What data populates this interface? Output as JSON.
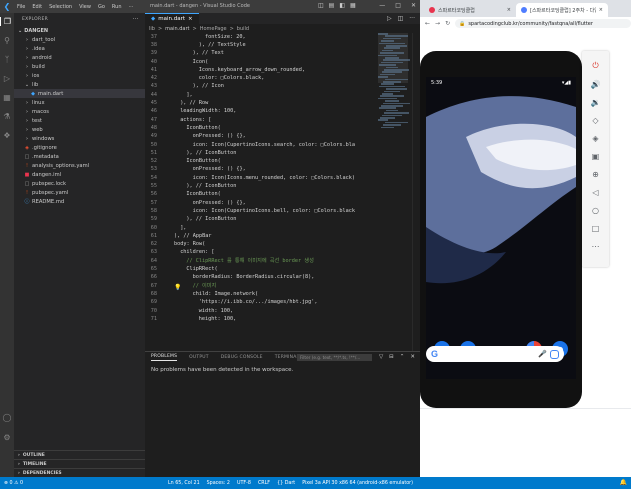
{
  "vscode": {
    "menu": [
      "File",
      "Edit",
      "Selection",
      "View",
      "Go",
      "Run",
      "···"
    ],
    "window_title": "main.dart - dangen - Visual Studio Code",
    "explorer_title": "EXPLORER",
    "project": "DANGEN",
    "tree": [
      {
        "label": "dart_tool",
        "icon": "chevron-right",
        "depth": 1
      },
      {
        "label": ".idea",
        "icon": "chevron-right",
        "depth": 1
      },
      {
        "label": "android",
        "icon": "chevron-right",
        "depth": 1
      },
      {
        "label": "build",
        "icon": "chevron-right",
        "depth": 1
      },
      {
        "label": "ios",
        "icon": "chevron-right",
        "depth": 1
      },
      {
        "label": "lib",
        "icon": "chevron-down",
        "depth": 1
      },
      {
        "label": "main.dart",
        "icon": "dart-file",
        "depth": 2,
        "selected": true
      },
      {
        "label": "linux",
        "icon": "chevron-right",
        "depth": 1
      },
      {
        "label": "macos",
        "icon": "chevron-right",
        "depth": 1
      },
      {
        "label": "test",
        "icon": "chevron-right",
        "depth": 1
      },
      {
        "label": "web",
        "icon": "chevron-right",
        "depth": 1
      },
      {
        "label": "windows",
        "icon": "chevron-right",
        "depth": 1
      },
      {
        "label": ".gitignore",
        "icon": "git-file",
        "depth": 1
      },
      {
        "label": ".metadata",
        "icon": "config-file",
        "depth": 1
      },
      {
        "label": "analysis_options.yaml",
        "icon": "yaml-file",
        "depth": 1
      },
      {
        "label": "dangen.iml",
        "icon": "iml-file",
        "depth": 1
      },
      {
        "label": "pubspec.lock",
        "icon": "lock-file",
        "depth": 1
      },
      {
        "label": "pubspec.yaml",
        "icon": "yaml-file",
        "depth": 1
      },
      {
        "label": "README.md",
        "icon": "info-file",
        "depth": 1
      }
    ],
    "sections": [
      "OUTLINE",
      "TIMELINE",
      "DEPENDENCIES"
    ],
    "tab": {
      "label": "main.dart",
      "close": "×"
    },
    "breadcrumbs": [
      "lib",
      ">",
      "main.dart",
      ">",
      "HomePage",
      ">",
      "build"
    ],
    "code": [
      {
        "n": "37",
        "indent": 10,
        "text": "fontSize: 20,",
        "k": "txt"
      },
      {
        "n": "38",
        "indent": 9,
        "text": "), // TextStyle",
        "k": "txt"
      },
      {
        "n": "39",
        "indent": 8,
        "text": "), // Text",
        "k": "txt"
      },
      {
        "n": "40",
        "indent": 8,
        "text": "Icon(",
        "k": "txt"
      },
      {
        "n": "41",
        "indent": 9,
        "text": "Icons.keyboard_arrow_down_rounded,",
        "k": "txt"
      },
      {
        "n": "42",
        "indent": 9,
        "text": "color: □Colors.black,",
        "k": "txt"
      },
      {
        "n": "43",
        "indent": 8,
        "text": "), // Icon",
        "k": "txt"
      },
      {
        "n": "44",
        "indent": 7,
        "text": "],",
        "k": "txt"
      },
      {
        "n": "45",
        "indent": 6,
        "text": "), // Row",
        "k": "txt"
      },
      {
        "n": "46",
        "indent": 6,
        "text": "leadingWidth: 100,",
        "k": "txt"
      },
      {
        "n": "47",
        "indent": 6,
        "text": "actions: [",
        "k": "txt"
      },
      {
        "n": "48",
        "indent": 7,
        "text": "IconButton(",
        "k": "txt"
      },
      {
        "n": "49",
        "indent": 8,
        "text": "onPressed: () {},",
        "k": "txt"
      },
      {
        "n": "50",
        "indent": 8,
        "text": "icon: Icon(CupertinoIcons.search, color: □Colors.bla",
        "k": "txt"
      },
      {
        "n": "51",
        "indent": 7,
        "text": "), // IconButton",
        "k": "txt"
      },
      {
        "n": "52",
        "indent": 7,
        "text": "IconButton(",
        "k": "txt"
      },
      {
        "n": "53",
        "indent": 8,
        "text": "onPressed: () {},",
        "k": "txt"
      },
      {
        "n": "54",
        "indent": 8,
        "text": "icon: Icon(Icons.menu_rounded, color: □Colors.black)",
        "k": "txt"
      },
      {
        "n": "55",
        "indent": 7,
        "text": "), // IconButton",
        "k": "txt"
      },
      {
        "n": "56",
        "indent": 7,
        "text": "IconButton(",
        "k": "txt"
      },
      {
        "n": "57",
        "indent": 8,
        "text": "onPressed: () {},",
        "k": "txt"
      },
      {
        "n": "58",
        "indent": 8,
        "text": "icon: Icon(CupertinoIcons.bell, color: □Colors.black",
        "k": "txt"
      },
      {
        "n": "59",
        "indent": 7,
        "text": "), // IconButton",
        "k": "txt"
      },
      {
        "n": "60",
        "indent": 6,
        "text": "],",
        "k": "txt"
      },
      {
        "n": "61",
        "indent": 5,
        "text": "), // AppBar",
        "k": "txt"
      },
      {
        "n": "62",
        "indent": 5,
        "text": "body: Row(",
        "k": "txt"
      },
      {
        "n": "63",
        "indent": 6,
        "text": "children: [",
        "k": "txt"
      },
      {
        "n": "64",
        "indent": 7,
        "text": "// ClipRRect 를 통해 이미지에 곡선 border 생성",
        "k": "cmt"
      },
      {
        "n": "65",
        "indent": 7,
        "text": "ClipRRect(",
        "k": "txt"
      },
      {
        "n": "66",
        "indent": 8,
        "text": "borderRadius: BorderRadius.circular(8),",
        "k": "txt"
      },
      {
        "n": "67",
        "indent": 8,
        "text": "// 이미지",
        "k": "cmt"
      },
      {
        "n": "68",
        "indent": 8,
        "text": "child: Image.network(",
        "k": "txt"
      },
      {
        "n": "69",
        "indent": 9,
        "text": "'https://i.ibb.co/.../images/hbt.jpg',",
        "k": "txt"
      },
      {
        "n": "70",
        "indent": 9,
        "text": "width: 100,",
        "k": "txt"
      },
      {
        "n": "71",
        "indent": 9,
        "text": "height: 100,",
        "k": "txt"
      }
    ],
    "panel_tabs": [
      "PROBLEMS",
      "OUTPUT",
      "DEBUG CONSOLE",
      "TERMINAL"
    ],
    "panel_filter_placeholder": "Filter (e.g. text, **/*.ts, !**/...",
    "panel_message": "No problems have been detected in the workspace.",
    "status_left": [
      "⊗ 0 ⚠ 0"
    ],
    "status_right": [
      "Ln 65, Col 21",
      "Spaces: 2",
      "UTF-8",
      "CRLF",
      "{} Dart",
      "Pixel 3a API 30 x86 64 (android-x86 emulator)"
    ]
  },
  "chrome": {
    "tabs": [
      {
        "label": "스파르타코딩클럽",
        "active": false,
        "favicon_color": "#e8344e"
      },
      {
        "label": "[스파르타코딩클럽] 2주차 - 다양한 위젯을 활용해보자",
        "active": true,
        "favicon_color": "#4f7dff"
      }
    ],
    "url": "spartacodingclub.kr/community/fastqna/all/flutter"
  },
  "emulator": {
    "time": "5:39",
    "signal": "▾◢▮",
    "tools": [
      "power-icon",
      "volume-up-icon",
      "volume-down-icon",
      "rotate-left-icon",
      "rotate-right-icon",
      "camera-icon",
      "zoom-icon",
      "back-icon",
      "home-icon",
      "overview-icon",
      "more-icon"
    ]
  },
  "colors": {
    "accent": "#007acc",
    "comment": "#6a9955",
    "dart": "#3ea6ff"
  }
}
